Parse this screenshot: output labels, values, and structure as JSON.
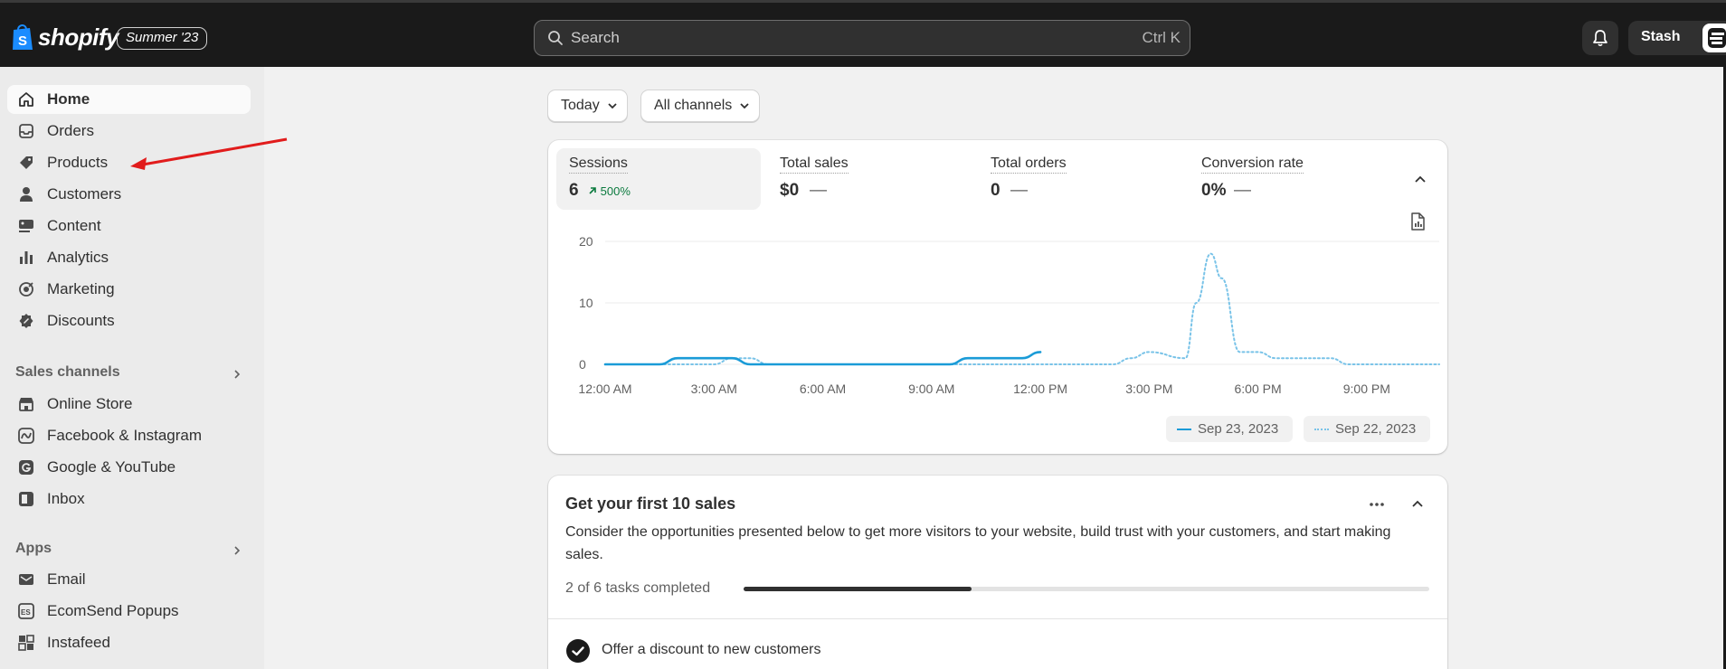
{
  "topbar": {
    "brand": "shopify",
    "edition": "Summer '23",
    "search_placeholder": "Search",
    "search_shortcut": "Ctrl K",
    "store_name": "Stash"
  },
  "sidebar": {
    "items": [
      {
        "label": "Home",
        "icon": "home-icon",
        "active": true
      },
      {
        "label": "Orders",
        "icon": "inbox-tray-icon"
      },
      {
        "label": "Products",
        "icon": "tag-icon"
      },
      {
        "label": "Customers",
        "icon": "person-icon"
      },
      {
        "label": "Content",
        "icon": "image-text-icon"
      },
      {
        "label": "Analytics",
        "icon": "bar-chart-icon"
      },
      {
        "label": "Marketing",
        "icon": "target-icon"
      },
      {
        "label": "Discounts",
        "icon": "discount-badge-icon"
      }
    ],
    "sales_channels_title": "Sales channels",
    "sales_channels": [
      {
        "label": "Online Store",
        "icon": "storefront-icon"
      },
      {
        "label": "Facebook & Instagram",
        "icon": "meta-icon"
      },
      {
        "label": "Google & YouTube",
        "icon": "google-icon"
      },
      {
        "label": "Inbox",
        "icon": "inbox-icon"
      }
    ],
    "apps_title": "Apps",
    "apps": [
      {
        "label": "Email",
        "icon": "email-icon"
      },
      {
        "label": "EcomSend Popups",
        "icon": "ecomsend-icon"
      },
      {
        "label": "Instafeed",
        "icon": "grid-icon"
      }
    ]
  },
  "filters": {
    "date": "Today",
    "channel": "All channels"
  },
  "metrics": [
    {
      "label": "Sessions",
      "value": "6",
      "change": "500%"
    },
    {
      "label": "Total sales",
      "value": "$0"
    },
    {
      "label": "Total orders",
      "value": "0"
    },
    {
      "label": "Conversion rate",
      "value": "0%"
    }
  ],
  "chart_data": {
    "type": "line",
    "title": "",
    "xlabel": "",
    "ylabel": "",
    "x_ticks": [
      "12:00 AM",
      "3:00 AM",
      "6:00 AM",
      "9:00 AM",
      "12:00 PM",
      "3:00 PM",
      "6:00 PM",
      "9:00 PM"
    ],
    "y_ticks": [
      0,
      10,
      20
    ],
    "ylim": [
      0,
      20
    ],
    "xlim": [
      0,
      23
    ],
    "grid": true,
    "legend_position": "bottom-right",
    "series": [
      {
        "name": "Sep 23, 2023",
        "color": "#1a9bd7",
        "style": "solid",
        "x": [
          0,
          1,
          1.5,
          2,
          3,
          3.5,
          4,
          5,
          6,
          7,
          8,
          9,
          9.5,
          10,
          11,
          11.5,
          12
        ],
        "y": [
          0,
          0,
          0,
          1,
          1,
          1,
          0,
          0,
          0,
          0,
          0,
          0,
          0,
          1,
          1,
          1,
          2
        ]
      },
      {
        "name": "Sep 22, 2023",
        "color": "#79c3e8",
        "style": "dotted",
        "x": [
          0,
          1,
          2,
          3,
          3.5,
          4,
          4.5,
          5,
          6,
          7,
          8,
          9,
          10,
          11,
          12,
          13,
          14,
          14.5,
          15,
          16,
          16.3,
          16.7,
          17,
          17.5,
          18,
          18.5,
          19,
          20,
          20.5,
          21,
          22,
          23
        ],
        "y": [
          0,
          0,
          0,
          0,
          1,
          1,
          0,
          0,
          0,
          0,
          0,
          0,
          0,
          0,
          0,
          0,
          0,
          1,
          2,
          1,
          10,
          18,
          14,
          2,
          2,
          1,
          1,
          1,
          0,
          0,
          0,
          0
        ]
      }
    ]
  },
  "get_sales": {
    "title": "Get your first 10 sales",
    "description": "Consider the opportunities presented below to get more visitors to your website, build trust with your customers, and start making sales.",
    "progress_label": "2 of 6 tasks completed",
    "progress_fraction": 0.333,
    "first_task": "Offer a discount to new customers"
  },
  "colors": {
    "topbar_bg": "#1a1a1a",
    "sidebar_bg": "#ebebeb",
    "accent_blue": "#1a9bd7",
    "positive_green": "#0b7a3e",
    "annotation_red": "#e11c1c"
  }
}
